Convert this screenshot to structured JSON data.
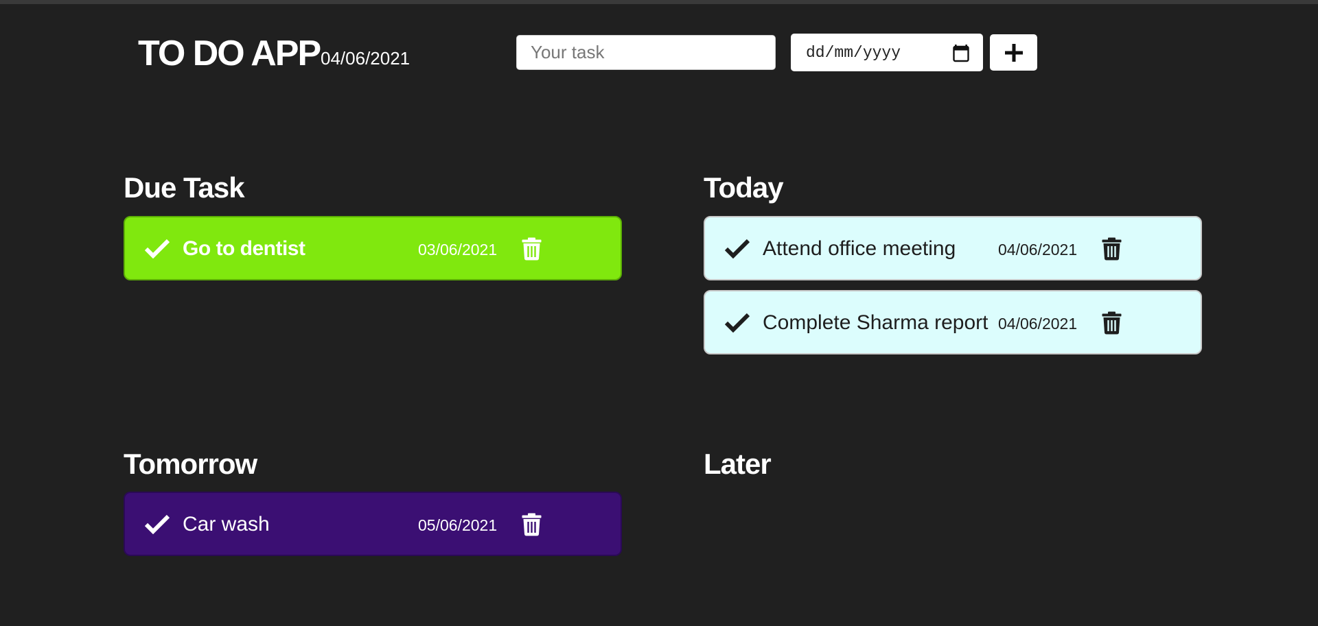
{
  "header": {
    "title": "TO DO APP",
    "date": "04/06/2021"
  },
  "form": {
    "task_placeholder": "Your task",
    "date_placeholder": "dd/mm/yyyy",
    "add_icon": "plus-icon",
    "calendar_icon": "calendar-icon"
  },
  "icons": {
    "complete": "check-icon",
    "delete": "trash-icon"
  },
  "colors": {
    "background": "#202020",
    "due_card": "#80e80e",
    "today_card": "#dcfdfd",
    "tomorrow_card": "#3b0f73"
  },
  "sections": {
    "due": {
      "heading": "Due Task",
      "tasks": [
        {
          "title": "Go to dentist",
          "date": "03/06/2021"
        }
      ]
    },
    "today": {
      "heading": "Today",
      "tasks": [
        {
          "title": "Attend office meeting",
          "date": "04/06/2021"
        },
        {
          "title": "Complete Sharma report",
          "date": "04/06/2021"
        }
      ]
    },
    "tomorrow": {
      "heading": "Tomorrow",
      "tasks": [
        {
          "title": "Car wash",
          "date": "05/06/2021"
        }
      ]
    },
    "later": {
      "heading": "Later",
      "tasks": []
    }
  }
}
